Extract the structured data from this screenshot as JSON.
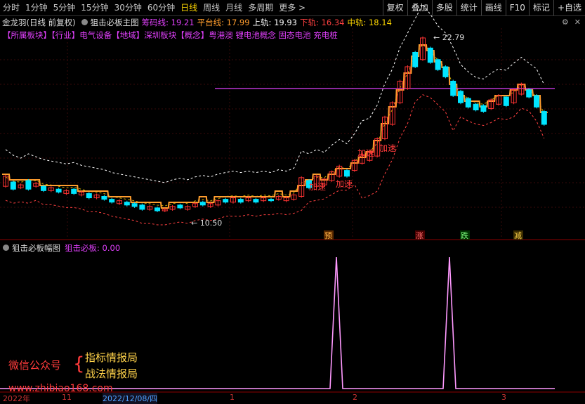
{
  "topbar": {
    "periods": [
      "分时",
      "1分钟",
      "5分钟",
      "15分钟",
      "30分钟",
      "60分钟",
      "日线",
      "周线",
      "月线",
      "多周期",
      "更多 >"
    ],
    "active": "日线",
    "tools": [
      "复权",
      "叠加",
      "多股",
      "统计",
      "画线",
      "F10",
      "标记",
      "+自选"
    ]
  },
  "main": {
    "stock": "金龙羽(日线 前复权)",
    "indicator": "狙击必板主图",
    "lines": [
      {
        "label": "筹码线: 19.21",
        "color": "#e040fb"
      },
      {
        "label": "平台线: 17.99",
        "color": "#ff9d2e"
      },
      {
        "label": "上轨: 19.93",
        "color": "#ffffff"
      },
      {
        "label": "下轨: 16.34",
        "color": "#ff4040"
      },
      {
        "label": "中轨: 18.14",
        "color": "#ffd700"
      }
    ],
    "concept": "【所属板块】【行业】电气设备【地域】深圳板块【概念】粤港澳 锂电池概念 固态电池 充电桩",
    "high_label": "22.79",
    "low_label": "10.50",
    "accel_label": "加速",
    "signals": [
      "预",
      "涨",
      "跌",
      "减"
    ]
  },
  "sub": {
    "indicator": "狙击必板幅图",
    "value": "狙击必板: 0.00"
  },
  "watermark": {
    "left": "微信公众号",
    "line1": "指标情报局",
    "line2": "战法情报局",
    "url": "www.zhibiao168.com"
  },
  "xaxis": {
    "labels": [
      "2022年",
      "11",
      "2022/12/08/四",
      "1",
      "2",
      "3"
    ]
  },
  "colors": {
    "up": "#ff3333",
    "down": "#00e5ff",
    "platform": "#ff9d2e",
    "band_upper": "#ffffff",
    "band_lower": "#ff4040",
    "mid": "#ffd700",
    "chip": "#e040fb",
    "osc": "#ff99ff"
  }
}
